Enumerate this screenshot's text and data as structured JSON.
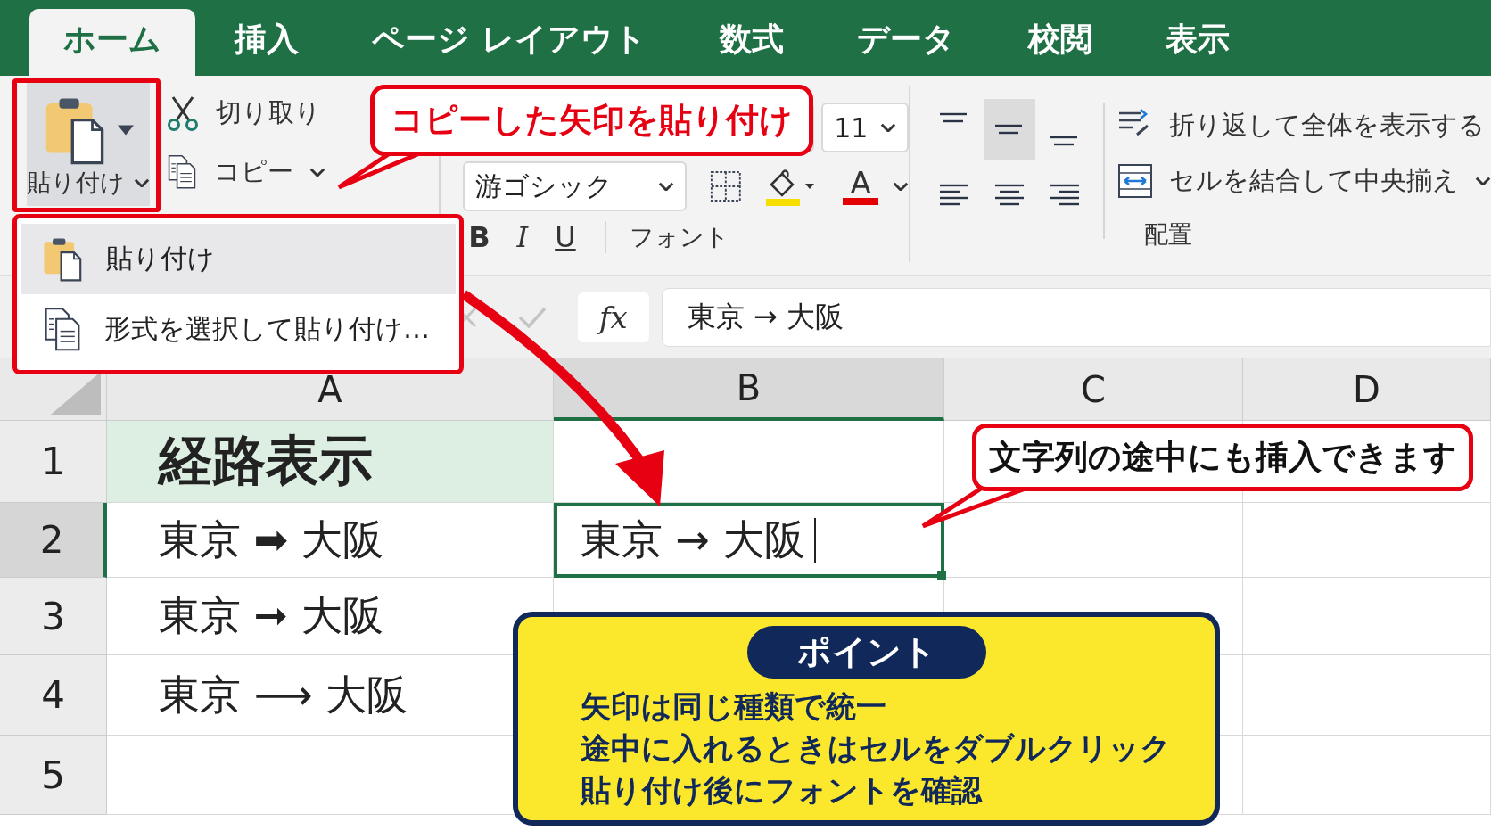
{
  "ribbon_tabs": [
    {
      "label": "ホーム",
      "selected": true
    },
    {
      "label": "挿入",
      "selected": false
    },
    {
      "label": "ページ レイアウト",
      "selected": false
    },
    {
      "label": "数式",
      "selected": false
    },
    {
      "label": "データ",
      "selected": false
    },
    {
      "label": "校閲",
      "selected": false
    },
    {
      "label": "表示",
      "selected": false
    }
  ],
  "clipboard": {
    "paste": "貼り付け",
    "cut": "切り取り",
    "copy": "コピー"
  },
  "font": {
    "size": "11",
    "name": "游ゴシック",
    "font_color": "A",
    "bold": "B",
    "italic": "I",
    "underline": "U",
    "group_label": "フォント"
  },
  "alignment": {
    "buttons": [
      {
        "kind": "top",
        "selected": false
      },
      {
        "kind": "middle",
        "selected": true
      },
      {
        "kind": "bottom",
        "selected": false
      },
      {
        "kind": "left",
        "selected": false
      },
      {
        "kind": "center",
        "selected": false
      },
      {
        "kind": "right",
        "selected": false
      }
    ],
    "wrap_text": "折り返して全体を表示する",
    "merge_center": "セルを結合して中央揃え",
    "group_label": "配置"
  },
  "paste_menu": {
    "items": [
      {
        "label": "貼り付け",
        "kind": "paste",
        "selected": true
      },
      {
        "label": "形式を選択して貼り付け…",
        "kind": "special",
        "selected": false
      }
    ]
  },
  "formula_bar": {
    "fx": "fx",
    "value": "東京 → 大阪"
  },
  "sheet": {
    "columns": [
      {
        "label": "A",
        "selected": false
      },
      {
        "label": "B",
        "selected": true
      },
      {
        "label": "C",
        "selected": false
      },
      {
        "label": "D",
        "selected": false
      }
    ],
    "rows": [
      {
        "header": "1",
        "selected": false,
        "cells": [
          {
            "text": "経路表示",
            "kind": "title",
            "editing": false
          }
        ]
      },
      {
        "header": "2",
        "selected": true,
        "cells": [
          {
            "text": "東京 ➡ 大阪",
            "kind": "normal",
            "editing": false
          },
          {
            "text": "東京 → 大阪",
            "kind": "normal",
            "editing": true
          }
        ]
      },
      {
        "header": "3",
        "selected": false,
        "cells": [
          {
            "text": "東京 ➞ 大阪",
            "kind": "normal",
            "editing": false
          }
        ]
      },
      {
        "header": "4",
        "selected": false,
        "cells": [
          {
            "text": "東京 ⟶ 大阪",
            "kind": "normal",
            "editing": false
          }
        ]
      },
      {
        "header": "5",
        "selected": false,
        "cells": []
      }
    ]
  },
  "callouts": [
    {
      "text": "コピーした矢印を貼り付け",
      "kind": "red"
    },
    {
      "text": "文字列の途中にも挿入できます",
      "kind": "black"
    }
  ],
  "point_box": {
    "title": "ポイント",
    "lines": [
      "矢印は同じ種類で統一",
      "途中に入れるときはセルをダブルクリック",
      "貼り付け後にフォントを確認"
    ]
  }
}
